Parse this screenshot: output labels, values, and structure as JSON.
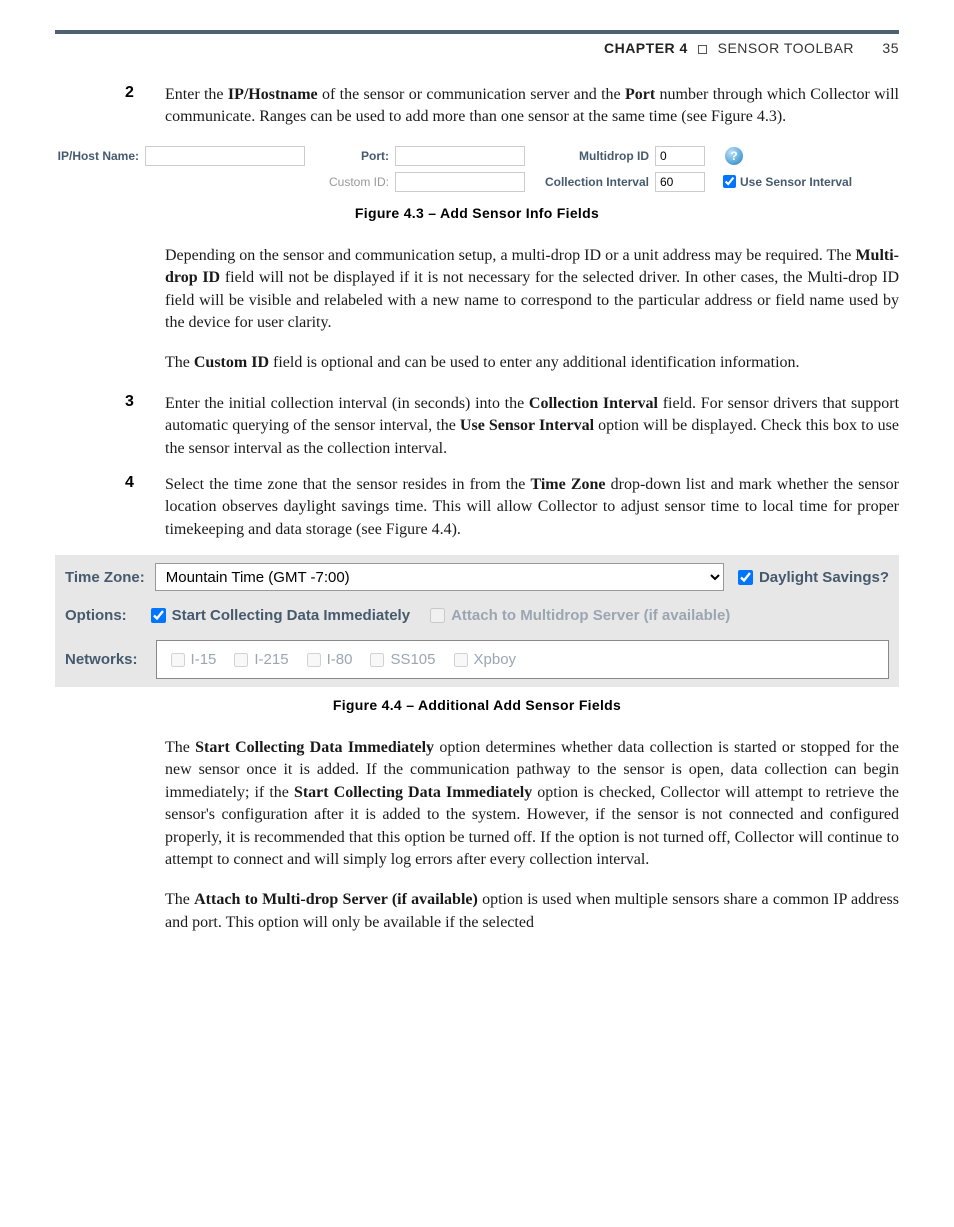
{
  "header": {
    "chapter": "CHAPTER 4",
    "title": "SENSOR TOOLBAR",
    "page": "35"
  },
  "step2": {
    "num": "2",
    "text_a": "Enter the ",
    "bold_a": "IP/Hostname",
    "text_b": " of the sensor or communication server and the ",
    "bold_b": "Port",
    "text_c": " number through which Collector will communicate. Ranges can be used to add more than one sensor at the same time (see Figure 4.3)."
  },
  "fig43": {
    "ip_label": "IP/Host Name:",
    "ip_value": "",
    "port_label": "Port:",
    "port_value": "",
    "custom_label": "Custom ID:",
    "custom_value": "",
    "multidrop_label": "Multidrop ID",
    "multidrop_value": "0",
    "help": "?",
    "collint_label": "Collection Interval",
    "collint_value": "60",
    "use_sensor_label": "Use Sensor Interval"
  },
  "caption43": "Figure 4.3 – Add Sensor Info Fields",
  "para_depending": {
    "a": "Depending on the sensor and communication setup, a multi-drop ID or a unit address may be required. The ",
    "b": "Multi-drop ID",
    "c": " field will not be displayed if it is not necessary for the selected driver. In other cases, the Multi-drop ID field will be visible and relabeled with a new name to correspond to the particular address or field name used by the device for user clarity."
  },
  "para_custom": {
    "a": "The ",
    "b": "Custom ID",
    "c": " field is optional and can be used to enter any additional identification information."
  },
  "step3": {
    "num": "3",
    "a": "Enter the initial collection interval (in seconds) into the ",
    "b": "Collection Interval",
    "c": " field. For sensor drivers that support automatic querying of the sensor interval, the ",
    "d": "Use Sensor Interval",
    "e": " option will be displayed. Check this box to use the sensor interval as the collection interval."
  },
  "step4": {
    "num": "4",
    "a": "Select the time zone that the sensor resides in from the ",
    "b": "Time Zone",
    "c": " drop-down list and mark whether the sensor location observes daylight savings time. This will allow Collector to adjust sensor time to local time for proper timekeeping and data storage (see Figure 4.4)."
  },
  "fig44": {
    "tz_label": "Time Zone:",
    "tz_value": "Mountain Time (GMT -7:00)",
    "daylight_label": "Daylight Savings?",
    "options_label": "Options:",
    "start_collecting_label": "Start Collecting Data Immediately",
    "attach_label": "Attach to Multidrop Server (if available)",
    "networks_label": "Networks:",
    "networks": [
      "I-15",
      "I-215",
      "I-80",
      "SS105",
      "Xpboy"
    ]
  },
  "caption44": "Figure 4.4 – Additional Add Sensor Fields",
  "para_start": {
    "a": "The ",
    "b": "Start Collecting Data Immediately",
    "c": " option determines whether data collection is started or stopped for the new sensor once it is added. If the communication pathway to the sensor is open, data collection can begin immediately; if the ",
    "d": "Start Collecting Data Immediately",
    "e": " option is checked, Collector will attempt to retrieve the sensor's configuration after it is added to the system. However, if the sensor is not connected and configured properly, it is recommended that this option be turned off.  If the option is not turned off, Collector will continue to attempt to connect and will simply log errors after every collection interval."
  },
  "para_attach": {
    "a": "The ",
    "b": "Attach to Multi-drop Server (if available)",
    "c": " option is used when multiple sensors share a common IP address and port. This option will only be available if the selected"
  }
}
